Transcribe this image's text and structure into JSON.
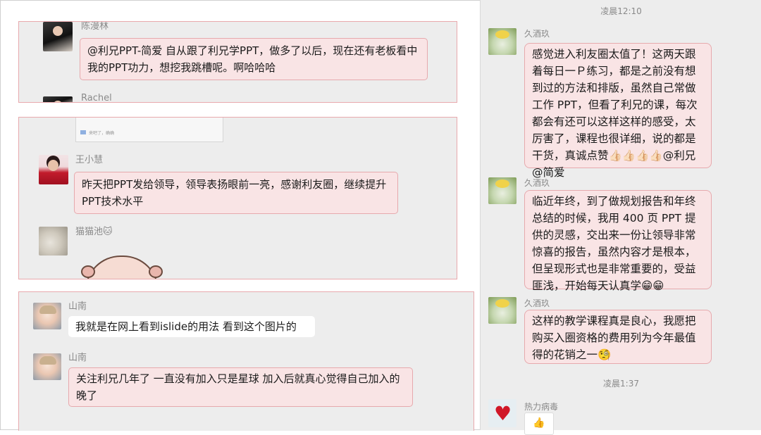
{
  "left": {
    "panel1": {
      "sender": "陈漫林",
      "message": "@利兄PPT-简爱 自从跟了利兄学PPT，做多了以后，现在还有老板看中我的PPT功力，想挖我跳槽呢。啊哈哈哈",
      "next_sender": "Rachel"
    },
    "panel2": {
      "thumb_caption": "来吧了，确确",
      "sender": "王小慧",
      "message": "昨天把PPT发给领导，领导表扬眼前一亮，感谢利友圈，继续提升PPT技术水平",
      "sender2": "猫猫池🐱"
    },
    "panel3": {
      "sender": "山南",
      "message": "我就是在网上看到islide的用法  看到这个图片的",
      "sender2": "山南",
      "message2": "关注利兄几年了 一直没有加入只是星球   加入后就真心觉得自己加入的晚了"
    }
  },
  "chat": {
    "timestamp1": "凌晨12:10",
    "sender1": "久酒玖",
    "message1": "感觉进入利友圈太值了！这两天跟着每日一Ｐ练习，都是之前没有想到过的方法和排版，虽然自己常做工作 PPT，但看了利兄的课，每次都会有还可以这样这样的感受，太厉害了，课程也很详细，说的都是干货，真诚点赞👍🏻👍🏻👍🏻👍🏻@利兄@简爱",
    "sender2": "久酒玖",
    "message2": "临近年终，到了做规划报告和年终总结的时候，我用 400 页 PPT 提供的灵感，交出来一份让领导非常惊喜的报告，虽然内容才是根本，但呈现形式也是非常重要的，受益匪浅，开始每天认真学😁😁",
    "sender3": "久酒玖",
    "message3": "这样的教学课程真是良心，我愿把购买入圈资格的费用列为今年最值得的花销之一🧐",
    "timestamp2": "凌晨1:37",
    "sender4": "热力病毒"
  },
  "colors": {
    "bubble_fill": "#f9e4e5",
    "bubble_border": "#e6a9ad",
    "panel_bg": "#ededed"
  }
}
